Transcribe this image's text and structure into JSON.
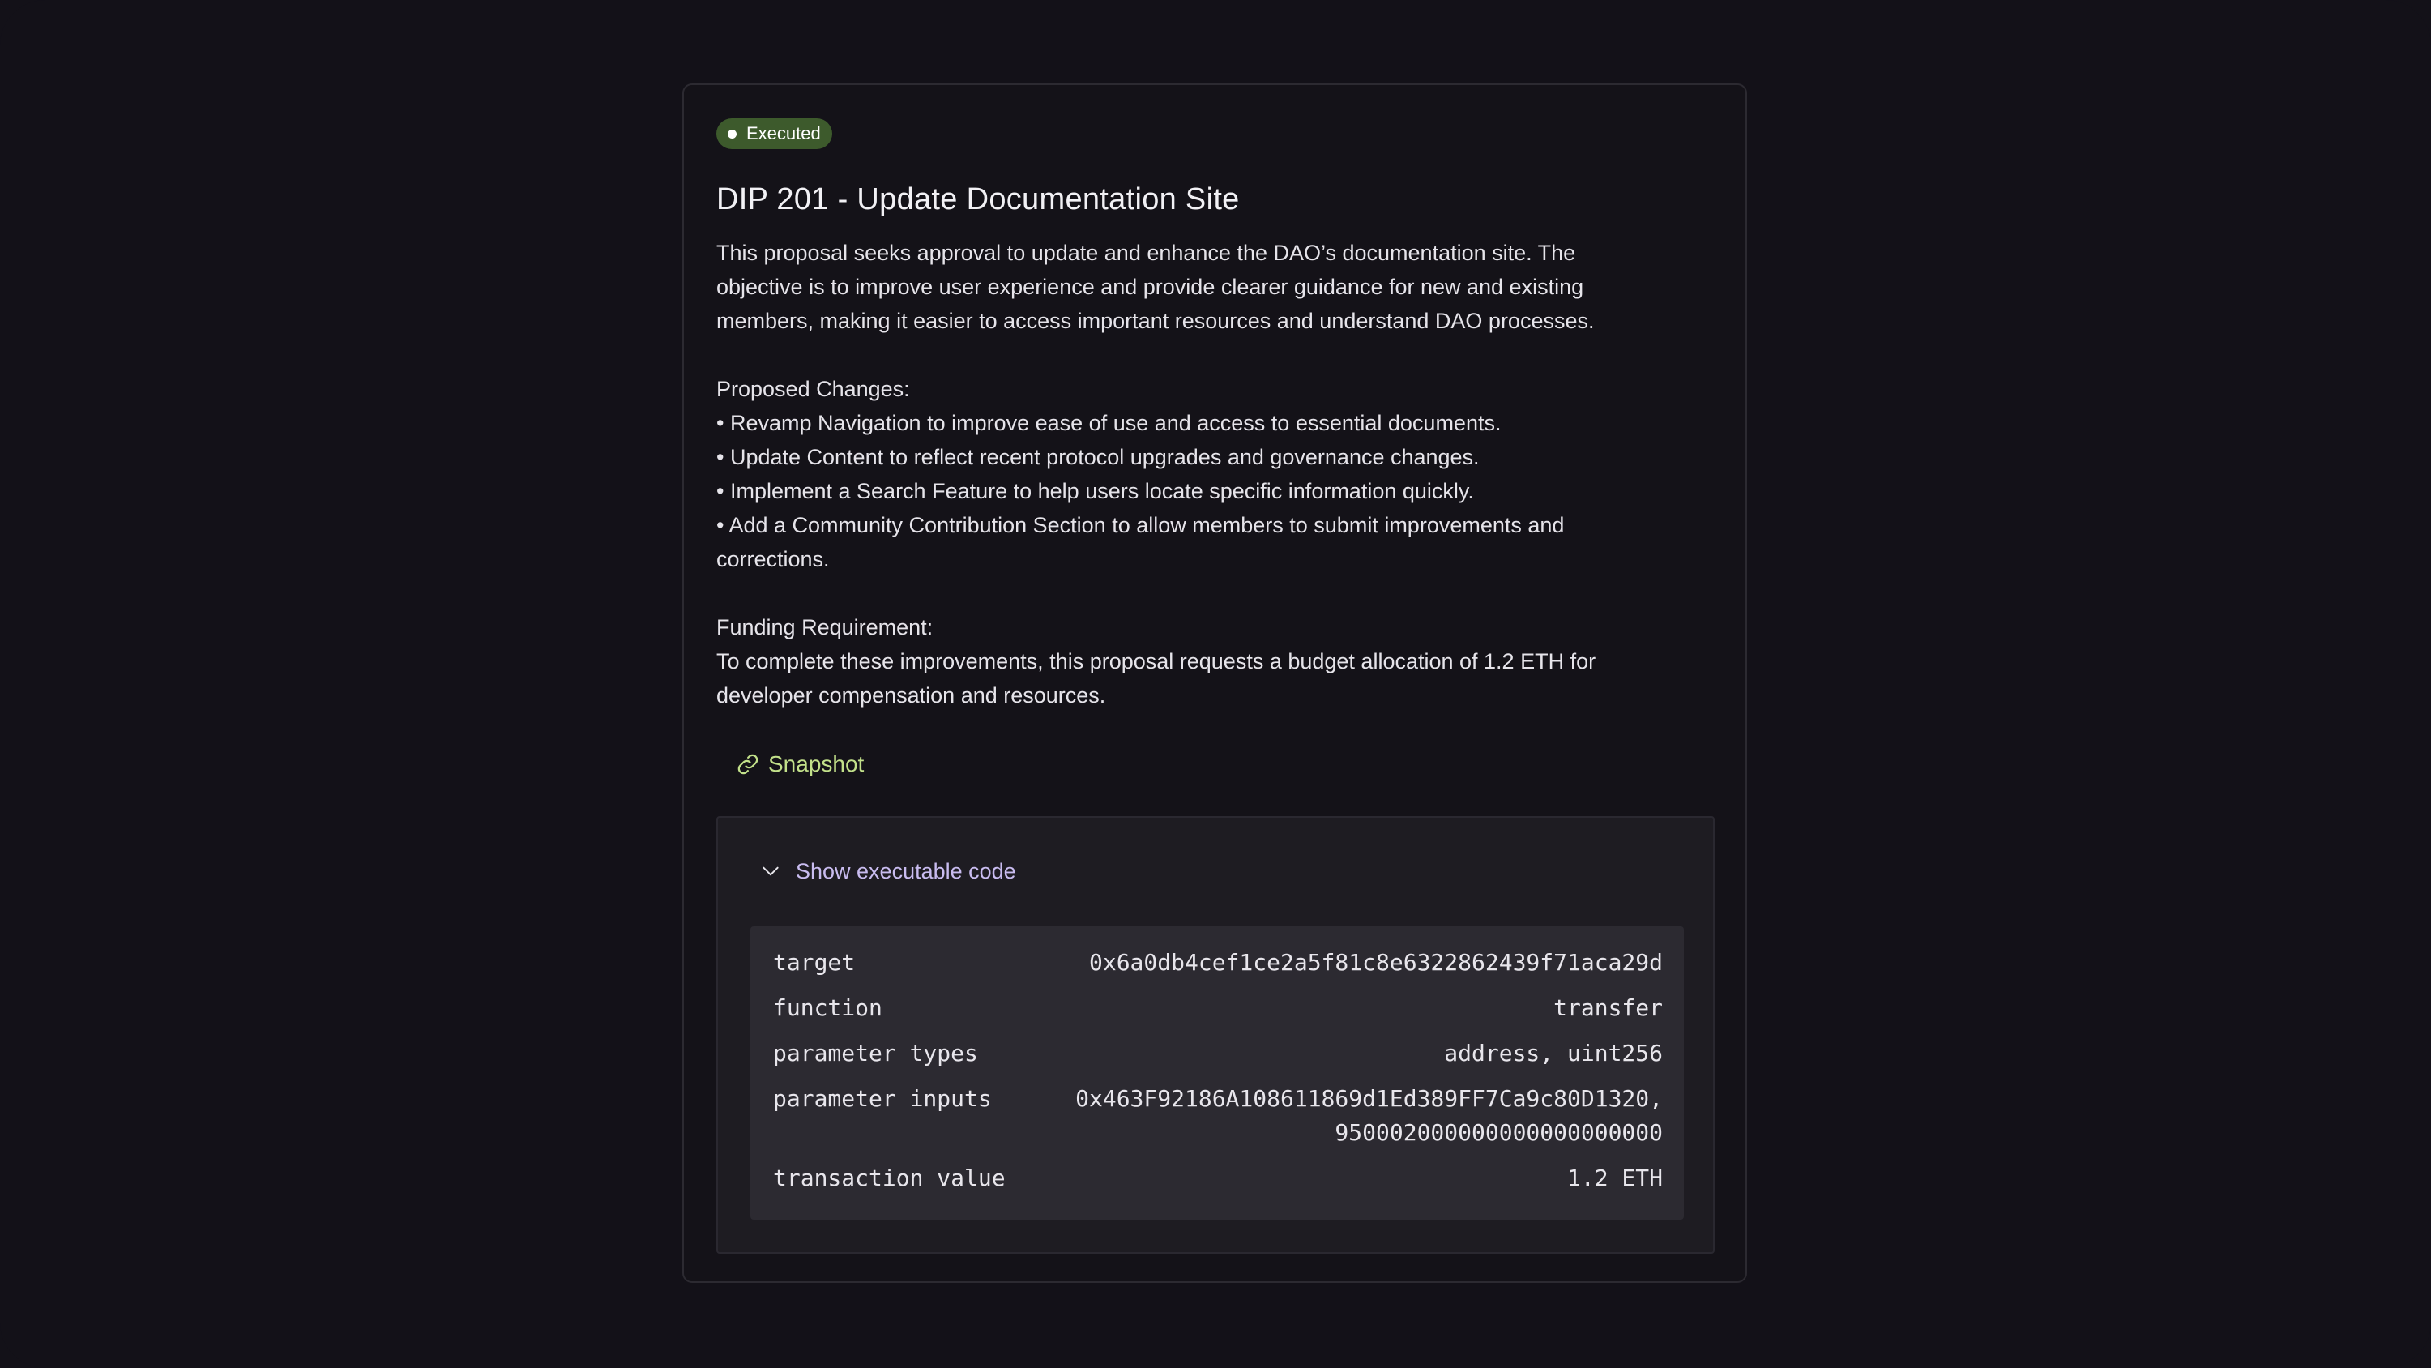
{
  "proposal": {
    "status": "Executed",
    "title": "DIP 201 - Update Documentation Site",
    "description": [
      "This proposal seeks approval to update and enhance the DAO’s documentation site. The",
      "objective is to improve user experience and provide clearer guidance for new and existing",
      "members, making it easier to access important resources and understand DAO processes."
    ],
    "changes_heading": "Proposed Changes:",
    "changes": [
      " • Revamp Navigation to improve ease of use and access to essential documents.",
      " • Update Content to reflect recent protocol upgrades and governance changes.",
      " • Implement a Search Feature to help users locate specific information quickly.",
      " • Add a Community Contribution Section to allow members to submit improvements and",
      "corrections."
    ],
    "funding_heading": "Funding Requirement:",
    "funding": [
      "To complete these improvements, this proposal requests a budget allocation of 1.2 ETH for",
      "developer compensation and resources."
    ],
    "link_label": "Snapshot"
  },
  "code": {
    "toggle_label": "Show executable code",
    "rows": [
      {
        "key": "target",
        "value": "0x6a0db4cef1ce2a5f81c8e6322862439f71aca29d"
      },
      {
        "key": "function",
        "value": "transfer"
      },
      {
        "key": "parameter types",
        "value": "address, uint256"
      },
      {
        "key": "parameter inputs",
        "value": "0x463F92186A108611869d1Ed389FF7Ca9c80D1320,",
        "value2": "950002000000000000000000"
      },
      {
        "key": "transaction value",
        "value": "1.2 ETH"
      }
    ]
  },
  "colors": {
    "background": "#131118",
    "badge": "#3d5a2c",
    "link": "#c2e08a",
    "toggle": "#c9bcf0"
  },
  "icons": {
    "status": "dot-icon",
    "link": "link-icon",
    "toggle": "chevron-down-icon"
  }
}
